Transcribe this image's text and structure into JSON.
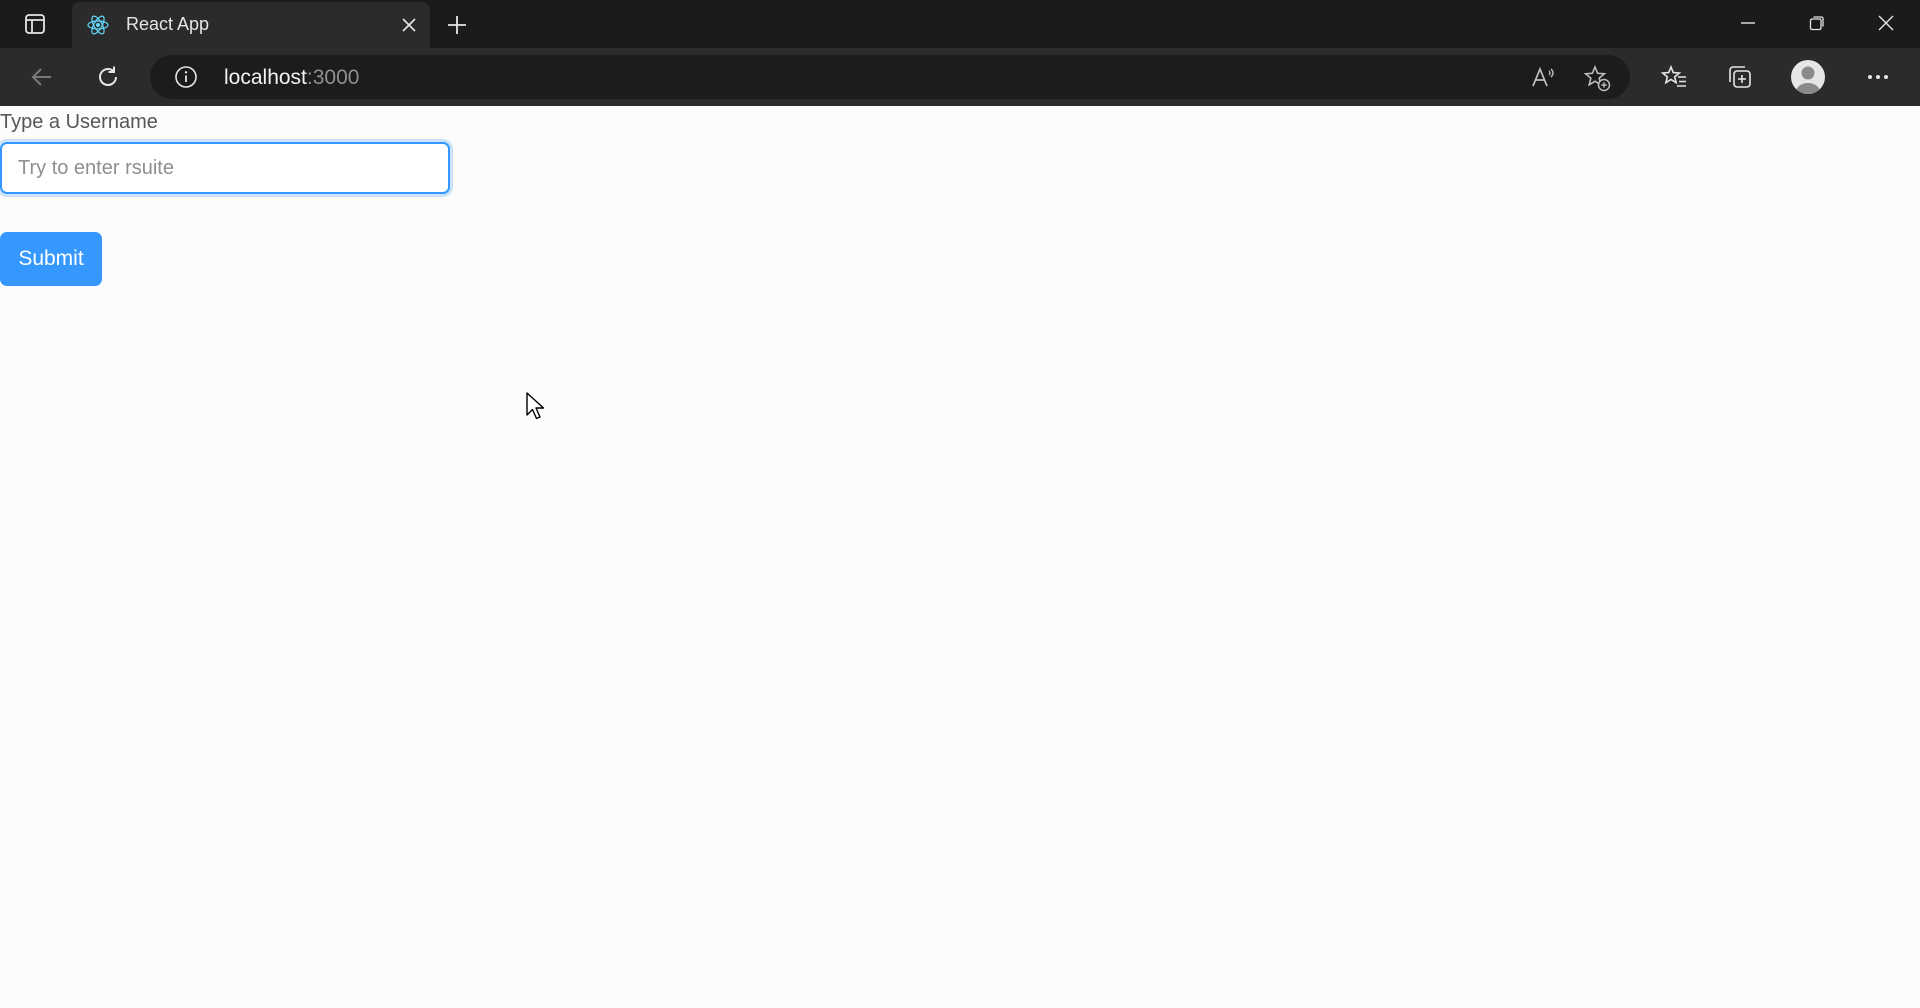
{
  "browser": {
    "tab": {
      "title": "React App",
      "favicon": "react-logo-icon"
    },
    "address_bar": {
      "host": "localhost",
      "port": ":3000"
    },
    "icons": {
      "tab_actions": "tab-actions-icon",
      "close_tab": "close-icon",
      "new_tab": "plus-icon",
      "minimize": "minimize-icon",
      "restore": "restore-icon",
      "close_window": "close-icon",
      "back": "back-arrow-icon",
      "refresh": "refresh-icon",
      "site_info": "info-icon",
      "read_aloud": "read-aloud-icon",
      "add_favorite": "star-add-icon",
      "favorites": "favorites-icon",
      "collections": "collections-icon",
      "profile": "profile-avatar-icon",
      "menu": "more-icon"
    },
    "colors": {
      "tabstrip_bg": "#1b1b1b",
      "toolbar_bg": "#2b2b2b",
      "address_bg": "#1c1c1c"
    }
  },
  "form": {
    "label": "Type a Username",
    "input": {
      "value": "",
      "placeholder": "Try to enter rsuite"
    },
    "submit_label": "Submit"
  },
  "colors": {
    "accent": "#3498ff",
    "page_bg": "#fcfcfa",
    "label_text": "#575757"
  }
}
